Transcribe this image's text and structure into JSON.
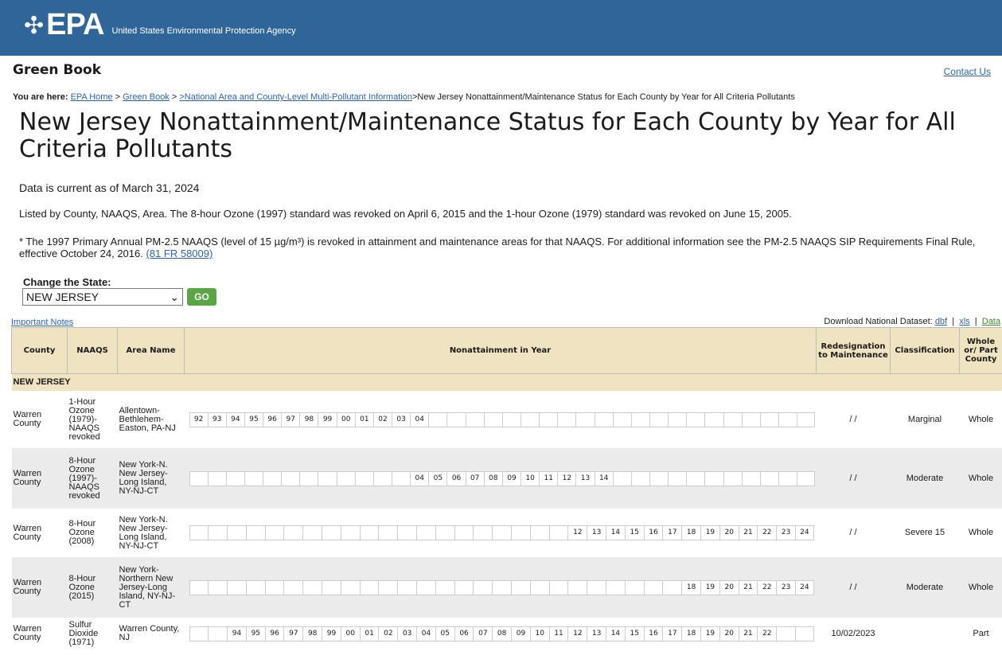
{
  "header": {
    "logo_text": "EPA",
    "agency": "United States Environmental Protection Agency"
  },
  "site_name": "Green Book",
  "contact_link": "Contact Us",
  "breadcrumb": {
    "prefix": "You are here:",
    "items": [
      "EPA Home",
      "Green Book",
      ">National Area and County-Level Multi-Pollutant Information"
    ],
    "current": ">New Jersey Nonattainment/Maintenance Status for Each County by Year for All Criteria Pollutants"
  },
  "title": "New Jersey Nonattainment/Maintenance Status for Each County by Year for All Criteria Pollutants",
  "as_of": "Data is current as of March 31, 2024",
  "intro": "Listed by County, NAAQS, Area. The 8-hour Ozone (1997) standard was revoked on April 6, 2015 and the 1-hour Ozone (1979) standard was revoked on June 15, 2005.",
  "note_pm": "* The 1997 Primary Annual PM-2.5 NAAQS (level of 15 µg/m³) is revoked in attainment and maintenance areas for that NAAQS. For additional information see the PM-2.5 NAAQS SIP Requirements Final Rule, effective October 24, 2016.",
  "note_link": "(81 FR 58009)",
  "state_form": {
    "label": "Change the State:",
    "selected": "NEW JERSEY",
    "go_label": "GO"
  },
  "important_notes": "Important Notes",
  "download": {
    "label": "Download National Dataset:",
    "dbf": "dbf",
    "xls": "xls",
    "data": "Data"
  },
  "table": {
    "headers": {
      "county": "County",
      "naaqs": "NAAQS",
      "area": "Area Name",
      "years": "Nonattainment in Year",
      "redes": "Redesignation to Maintenance",
      "class": "Classification",
      "whole": "Whole or/ Part County"
    },
    "state_name": "NEW JERSEY",
    "rows": [
      {
        "county": "Warren County",
        "naaqs": "1-Hour Ozone (1979)-NAAQS revoked",
        "area": "Allentown-Bethlehem-Easton, PA-NJ",
        "years": [
          "92",
          "93",
          "94",
          "95",
          "96",
          "97",
          "98",
          "99",
          "00",
          "01",
          "02",
          "03",
          "04",
          "",
          "",
          "",
          "",
          "",
          "",
          "",
          "",
          "",
          "",
          "",
          "",
          "",
          "",
          "",
          "",
          "",
          "",
          "",
          "",
          ""
        ],
        "redes": "/ /",
        "class": "Marginal",
        "whole": "Whole"
      },
      {
        "county": "Warren County",
        "naaqs": "8-Hour Ozone (1997)-NAAQS revoked",
        "area": "New York-N. New Jersey-Long Island, NY-NJ-CT",
        "years": [
          "",
          "",
          "",
          "",
          "",
          "",
          "",
          "",
          "",
          "",
          "",
          "",
          "04",
          "05",
          "06",
          "07",
          "08",
          "09",
          "10",
          "11",
          "12",
          "13",
          "14",
          "",
          "",
          "",
          "",
          "",
          "",
          "",
          "",
          "",
          "",
          ""
        ],
        "redes": "/ /",
        "class": "Moderate",
        "whole": "Whole"
      },
      {
        "county": "Warren County",
        "naaqs": "8-Hour Ozone (2008)",
        "area": "New York-N. New Jersey-Long Island, NY-NJ-CT",
        "years": [
          "",
          "",
          "",
          "",
          "",
          "",
          "",
          "",
          "",
          "",
          "",
          "",
          "",
          "",
          "",
          "",
          "",
          "",
          "",
          "",
          "12",
          "13",
          "14",
          "15",
          "16",
          "17",
          "18",
          "19",
          "20",
          "21",
          "22",
          "23",
          "24"
        ],
        "redes": "/ /",
        "class": "Severe 15",
        "whole": "Whole"
      },
      {
        "county": "Warren County",
        "naaqs": "8-Hour Ozone (2015)",
        "area": "New York-Northern New Jersey-Long Island, NY-NJ-CT",
        "years": [
          "",
          "",
          "",
          "",
          "",
          "",
          "",
          "",
          "",
          "",
          "",
          "",
          "",
          "",
          "",
          "",
          "",
          "",
          "",
          "",
          "",
          "",
          "",
          "",
          "",
          "",
          "18",
          "19",
          "20",
          "21",
          "22",
          "23",
          "24"
        ],
        "redes": "/ /",
        "class": "Moderate",
        "whole": "Whole"
      },
      {
        "county": "Warren County",
        "naaqs": "Sulfur Dioxide (1971)",
        "area": "Warren County, NJ",
        "years": [
          "",
          "",
          "94",
          "95",
          "96",
          "97",
          "98",
          "99",
          "00",
          "01",
          "02",
          "03",
          "04",
          "05",
          "06",
          "07",
          "08",
          "09",
          "10",
          "11",
          "12",
          "13",
          "14",
          "15",
          "16",
          "17",
          "18",
          "19",
          "20",
          "21",
          "22",
          "",
          ""
        ],
        "redes": "10/02/2023",
        "class": "",
        "whole": "Part"
      }
    ]
  },
  "colors": {
    "header_bg": "#2f6699",
    "table_header_bg": "#efe3c2",
    "link": "#2a63b8",
    "go_button": "#5aa646"
  }
}
